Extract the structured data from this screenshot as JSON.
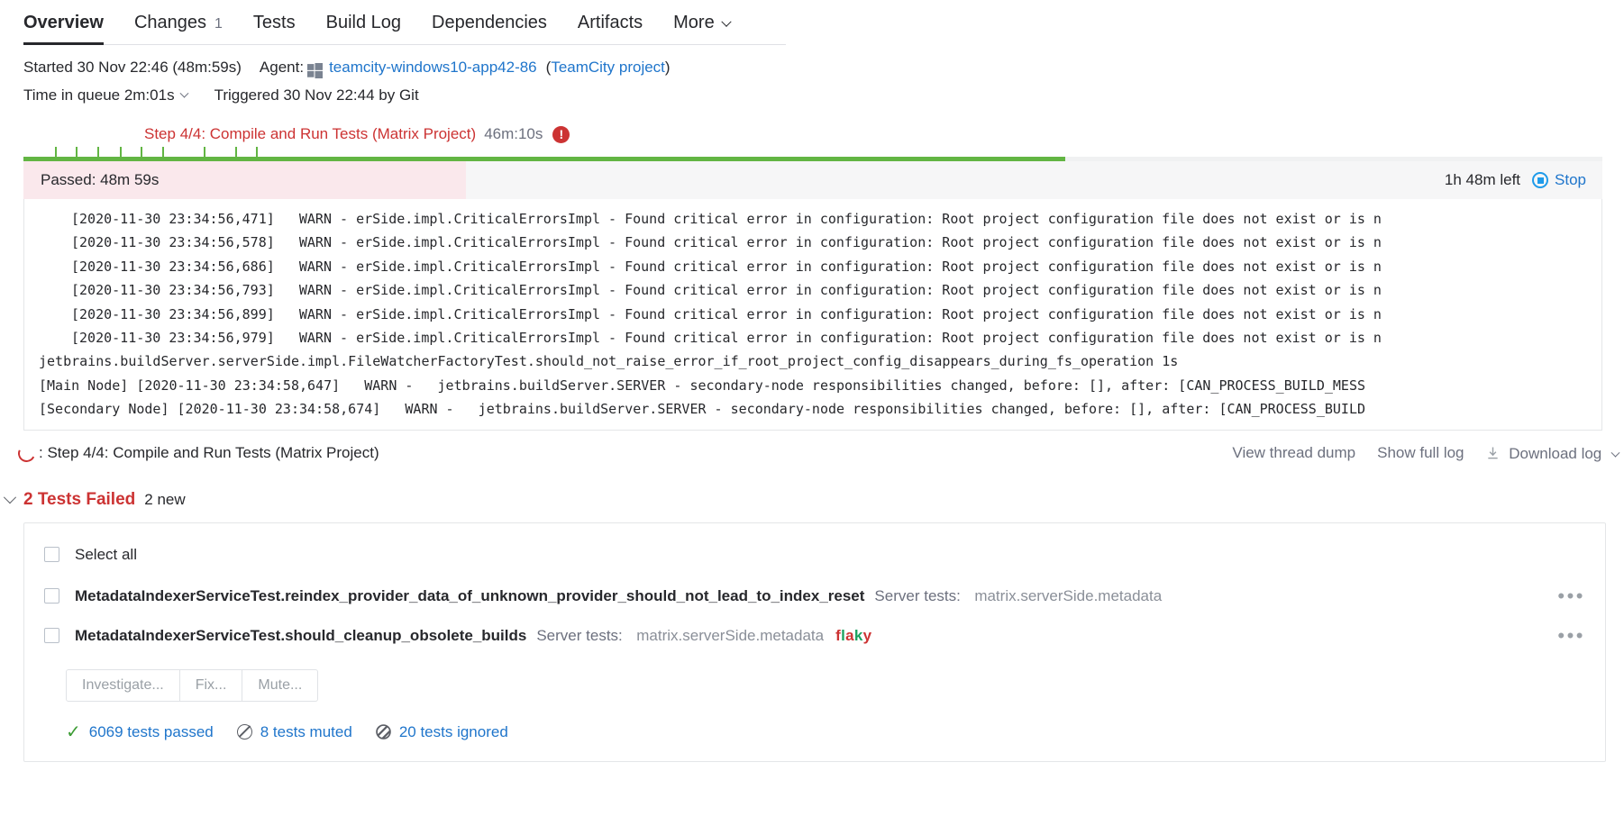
{
  "tabs": [
    {
      "label": "Overview",
      "badge": "",
      "active": true
    },
    {
      "label": "Changes",
      "badge": "1",
      "active": false
    },
    {
      "label": "Tests",
      "badge": "",
      "active": false
    },
    {
      "label": "Build Log",
      "badge": "",
      "active": false
    },
    {
      "label": "Dependencies",
      "badge": "",
      "active": false
    },
    {
      "label": "Artifacts",
      "badge": "",
      "active": false
    },
    {
      "label": "More",
      "badge": "",
      "active": false,
      "caret": true
    }
  ],
  "meta": {
    "started": "Started 30 Nov 22:46 (48m:59s)",
    "agent_label": "Agent:",
    "agent_icon": "windows-logo-icon",
    "agent_name": "teamcity-windows10-app42-86",
    "agent_project_open": "(",
    "agent_project": "TeamCity project",
    "agent_project_close": ")",
    "queue": "Time in queue 2m:01s",
    "triggered": "Triggered 30 Nov 22:44 by Git"
  },
  "step": {
    "title": "Step 4/4: Compile and Run Tests (Matrix Project)",
    "duration": "46m:10s",
    "error_glyph": "!",
    "progress_percent": 66,
    "ticks_percent": [
      2.0,
      3.3,
      4.7,
      6.1,
      7.4,
      8.8,
      11.4,
      13.4,
      14.7
    ],
    "status_label": "Passed: 48m 59s",
    "status_fill_percent": 28,
    "time_left": "1h 48m left",
    "stop_label": "Stop"
  },
  "log": {
    "lines": [
      {
        "indent": true,
        "text": "[2020-11-30 23:34:56,471]   WARN - erSide.impl.CriticalErrorsImpl - Found critical error in configuration: Root project configuration file does not exist or is n"
      },
      {
        "indent": true,
        "text": "[2020-11-30 23:34:56,578]   WARN - erSide.impl.CriticalErrorsImpl - Found critical error in configuration: Root project configuration file does not exist or is n"
      },
      {
        "indent": true,
        "text": "[2020-11-30 23:34:56,686]   WARN - erSide.impl.CriticalErrorsImpl - Found critical error in configuration: Root project configuration file does not exist or is n"
      },
      {
        "indent": true,
        "text": "[2020-11-30 23:34:56,793]   WARN - erSide.impl.CriticalErrorsImpl - Found critical error in configuration: Root project configuration file does not exist or is n"
      },
      {
        "indent": true,
        "text": "[2020-11-30 23:34:56,899]   WARN - erSide.impl.CriticalErrorsImpl - Found critical error in configuration: Root project configuration file does not exist or is n"
      },
      {
        "indent": true,
        "text": "[2020-11-30 23:34:56,979]   WARN - erSide.impl.CriticalErrorsImpl - Found critical error in configuration: Root project configuration file does not exist or is n"
      },
      {
        "indent": false,
        "text": "jetbrains.buildServer.serverSide.impl.FileWatcherFactoryTest.should_not_raise_error_if_root_project_config_disappears_during_fs_operation 1s"
      },
      {
        "indent": false,
        "text": "[Main Node] [2020-11-30 23:34:58,647]   WARN -   jetbrains.buildServer.SERVER - secondary-node responsibilities changed, before: [], after: [CAN_PROCESS_BUILD_MESS"
      },
      {
        "indent": false,
        "text": "[Secondary Node] [2020-11-30 23:34:58,674]   WARN -   jetbrains.buildServer.SERVER - secondary-node responsibilities changed, before: [], after: [CAN_PROCESS_BUILD"
      }
    ]
  },
  "log_footer": {
    "spinner_icon": "loading-spinner-icon",
    "label": ": Step 4/4: Compile and Run Tests (Matrix Project)",
    "view_thread_dump": "View thread dump",
    "show_full_log": "Show full log",
    "download_icon": "download-icon",
    "download_log": "Download log"
  },
  "tests": {
    "header_title": "2 Tests Failed",
    "header_new": "2 new",
    "select_all": "Select all",
    "suite_label": "Server tests:",
    "rows": [
      {
        "name": "MetadataIndexerServiceTest.reindex_provider_data_of_unknown_provider_should_not_lead_to_index_reset",
        "suite_label": "Server tests:",
        "suite": "matrix.serverSide.metadata",
        "flaky": "",
        "menu": "•••"
      },
      {
        "name": "MetadataIndexerServiceTest.should_cleanup_obsolete_builds",
        "suite_label": "Server tests:",
        "suite": "matrix.serverSide.metadata",
        "flaky": "flaky",
        "menu": "•••"
      }
    ],
    "buttons": [
      "Investigate...",
      "Fix...",
      "Mute..."
    ],
    "stats": [
      {
        "icon": "check-icon",
        "label": "6069 tests passed"
      },
      {
        "icon": "muted-icon",
        "label": "8 tests muted"
      },
      {
        "icon": "ignored-icon",
        "label": "20 tests ignored"
      }
    ]
  },
  "colors": {
    "accent_link": "#1f75cb",
    "error_red": "#cc3333",
    "success_green": "#62b543",
    "flaky_green": "#1aa260",
    "muted_text": "#8a8f98",
    "fail_bg": "#fae8ec"
  }
}
